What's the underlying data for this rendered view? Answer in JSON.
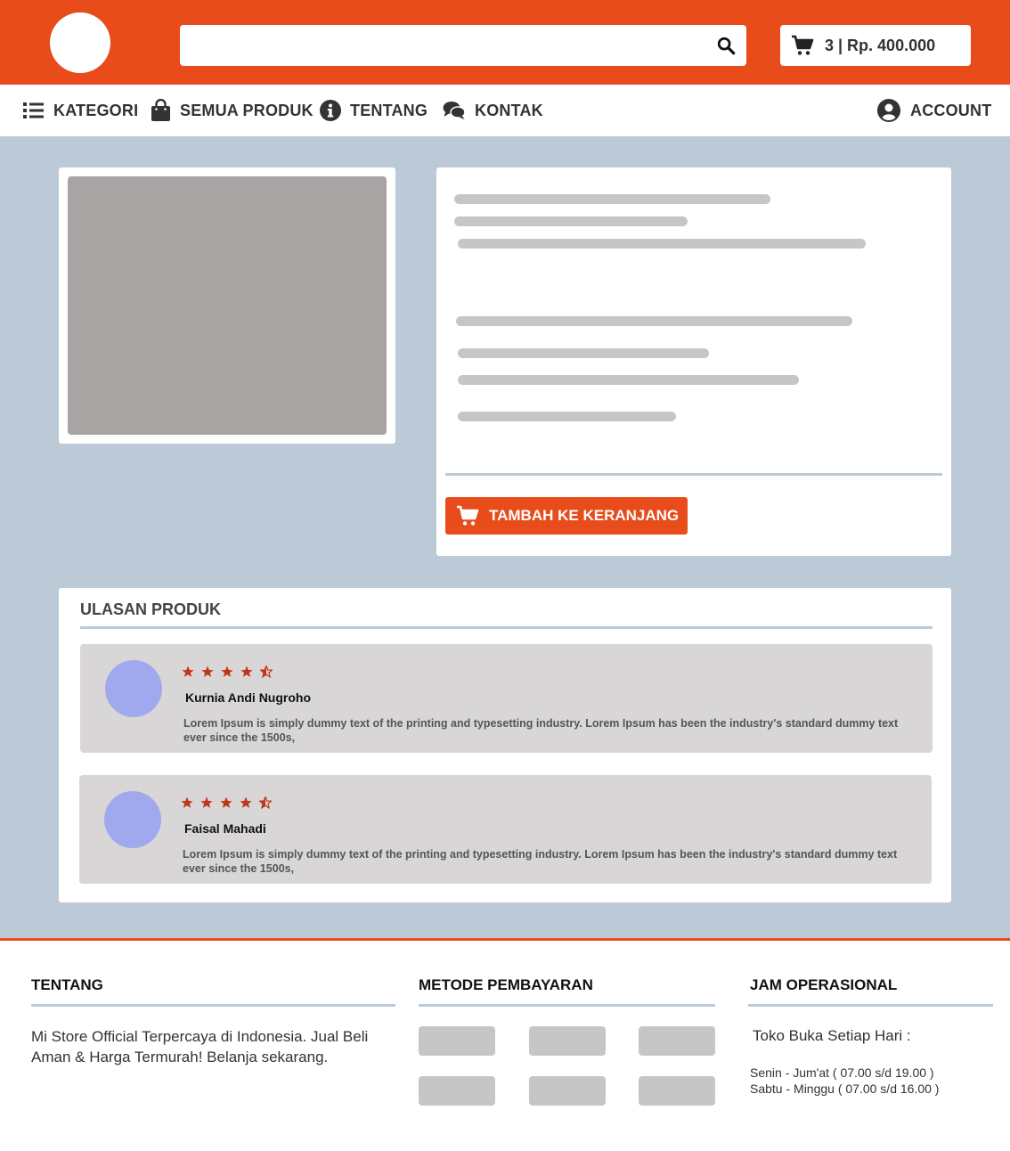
{
  "header": {
    "cart_summary": "3 | Rp. 400.000"
  },
  "nav": {
    "kategori": "KATEGORI",
    "semua_produk": "SEMUA PRODUK",
    "tentang": "TENTANG",
    "kontak": "KONTAK",
    "account": "ACCOUNT"
  },
  "product": {
    "add_to_cart_label": "TAMBAH KE KERANJANG"
  },
  "reviews": {
    "title": "ULASAN PRODUK",
    "items": [
      {
        "name": "Kurnia Andi Nugroho",
        "rating": 4.5,
        "text": "Lorem Ipsum is simply dummy text of the printing and typesetting industry. Lorem Ipsum has been the industry's standard dummy text ever since the 1500s,"
      },
      {
        "name": "Faisal Mahadi",
        "rating": 4.5,
        "text": "Lorem Ipsum is simply dummy text of the printing and typesetting industry. Lorem Ipsum has been the industry's standard dummy text ever since the 1500s,"
      }
    ]
  },
  "footer": {
    "tentang_title": "TENTANG",
    "tentang_text": "Mi Store Official Terpercaya di Indonesia. Jual Beli Aman & Harga Termurah! Belanja sekarang.",
    "payment_title": "METODE PEMBAYARAN",
    "hours_title": "JAM OPERASIONAL",
    "hours_intro": "Toko Buka Setiap Hari :",
    "hours_weekday": "Senin - Jum'at ( 07.00 s/d 19.00 )",
    "hours_weekend": "Sabtu - Minggu ( 07.00 s/d 16.00 )"
  },
  "colors": {
    "brand": "#e84c1b",
    "background": "#bccad7",
    "star": "#c0361a",
    "avatar": "#a0a9ee",
    "placeholder": "#c6c6c6"
  }
}
